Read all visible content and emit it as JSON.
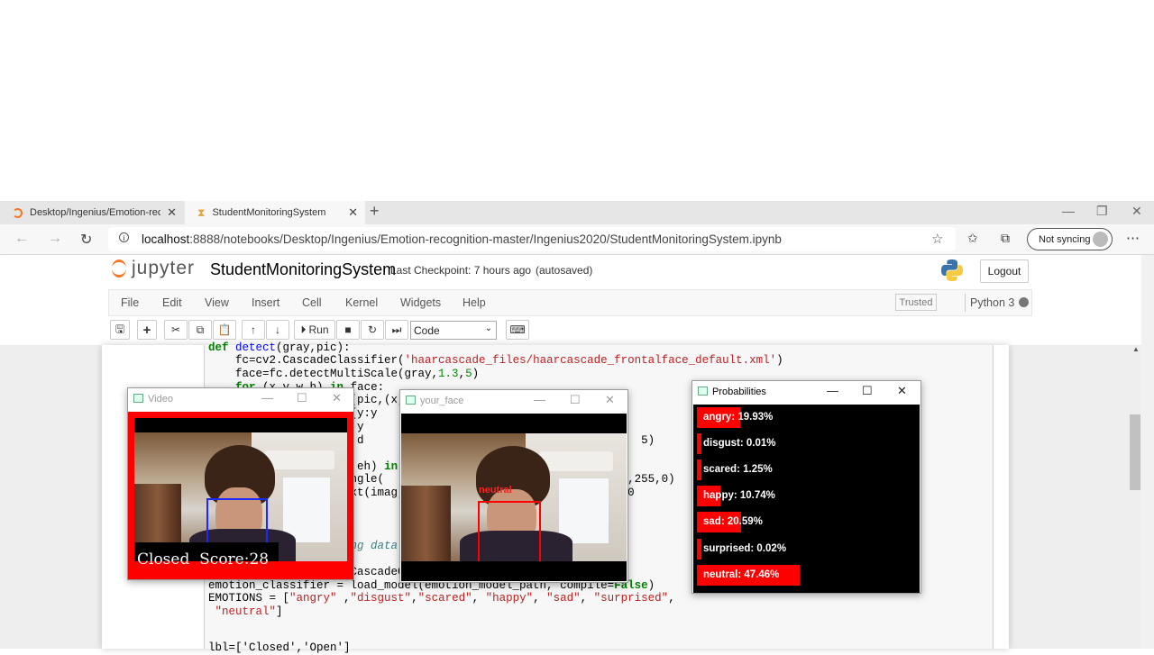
{
  "browser": {
    "tabs": [
      {
        "label": "Desktop/Ingenius/Emotion-recognition-master/",
        "active": false
      },
      {
        "label": "StudentMonitoringSystem",
        "active": true
      }
    ],
    "url_host": "localhost",
    "url_path": ":8888/notebooks/Desktop/Ingenius/Emotion-recognition-master/Ingenius2020/StudentMonitoringSystem.ipynb",
    "sync_label": "Not syncing"
  },
  "jupyter": {
    "logo_text": "jupyter",
    "notebook_title": "StudentMonitoringSystem",
    "checkpoint": "Last Checkpoint: 7 hours ago",
    "autosave": "(autosaved)",
    "logout": "Logout",
    "menu": [
      "File",
      "Edit",
      "View",
      "Insert",
      "Cell",
      "Kernel",
      "Widgets",
      "Help"
    ],
    "trusted": "Trusted",
    "kernel": "Python 3",
    "run_label": "Run",
    "cell_type": "Code"
  },
  "windows": {
    "video": {
      "title": "Video",
      "overlay_text": "Closed  Score:28"
    },
    "face": {
      "title": "your_face",
      "emotion_label": "neutral"
    },
    "probabilities": {
      "title": "Probabilities",
      "items": [
        {
          "label": "angry: 19.93%",
          "value": 19.93
        },
        {
          "label": "disgust: 0.01%",
          "value": 0.01
        },
        {
          "label": "scared: 1.25%",
          "value": 1.25
        },
        {
          "label": "happy: 10.74%",
          "value": 10.74
        },
        {
          "label": "sad: 20.59%",
          "value": 20.59
        },
        {
          "label": "surprised: 0.02%",
          "value": 0.02
        },
        {
          "label": "neutral: 47.46%",
          "value": 47.46
        }
      ]
    }
  },
  "colors": {
    "accent": "#f37726",
    "prob_bar": "#ff0000",
    "video_border": "#ff0000"
  }
}
